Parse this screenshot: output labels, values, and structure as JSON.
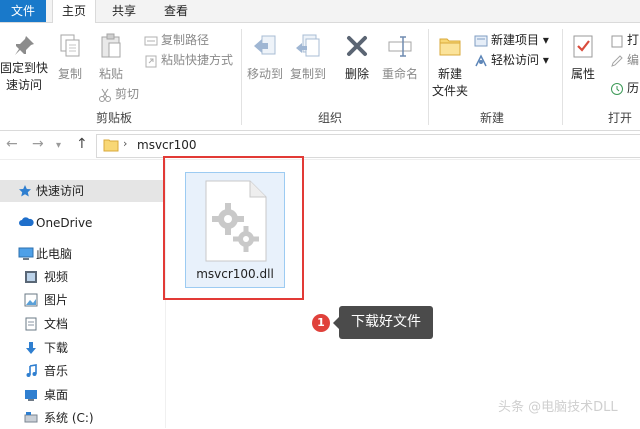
{
  "tabs": {
    "file": "文件",
    "home": "主页",
    "share": "共享",
    "view": "查看"
  },
  "ribbon": {
    "clipboard": {
      "pin_line1": "固定到快",
      "pin_line2": "速访问",
      "copy": "复制",
      "paste": "粘贴",
      "copy_path": "复制路径",
      "paste_shortcut": "粘贴快捷方式",
      "cut": "剪切",
      "label": "剪贴板"
    },
    "organize": {
      "move_to": "移动到",
      "copy_to": "复制到",
      "delete": "删除",
      "rename": "重命名",
      "label": "组织"
    },
    "new": {
      "new_folder_line1": "新建",
      "new_folder_line2": "文件夹",
      "new_item": "新建项目",
      "easy_access": "轻松访问",
      "label": "新建"
    },
    "open": {
      "properties": "属性",
      "open_partial": "打",
      "edit_partial": "编",
      "history_partial": "历",
      "label": "打开"
    }
  },
  "address": {
    "path": "msvcr100"
  },
  "nav": {
    "quick_access": "快速访问",
    "onedrive": "OneDrive",
    "this_pc": "此电脑",
    "videos": "视频",
    "pictures": "图片",
    "documents": "文档",
    "downloads": "下载",
    "music": "音乐",
    "desktop": "桌面",
    "system_c": "系统 (C:)"
  },
  "content": {
    "file_name": "msvcr100.dll"
  },
  "callout": {
    "number": "1",
    "text": "下载好文件"
  },
  "watermark": "头条 @电脑技术DLL",
  "colors": {
    "accent": "#1979ca",
    "highlight_border": "#e23a36",
    "callout_bg": "#4b4b4b",
    "selection_bg": "#e8f1fb"
  }
}
